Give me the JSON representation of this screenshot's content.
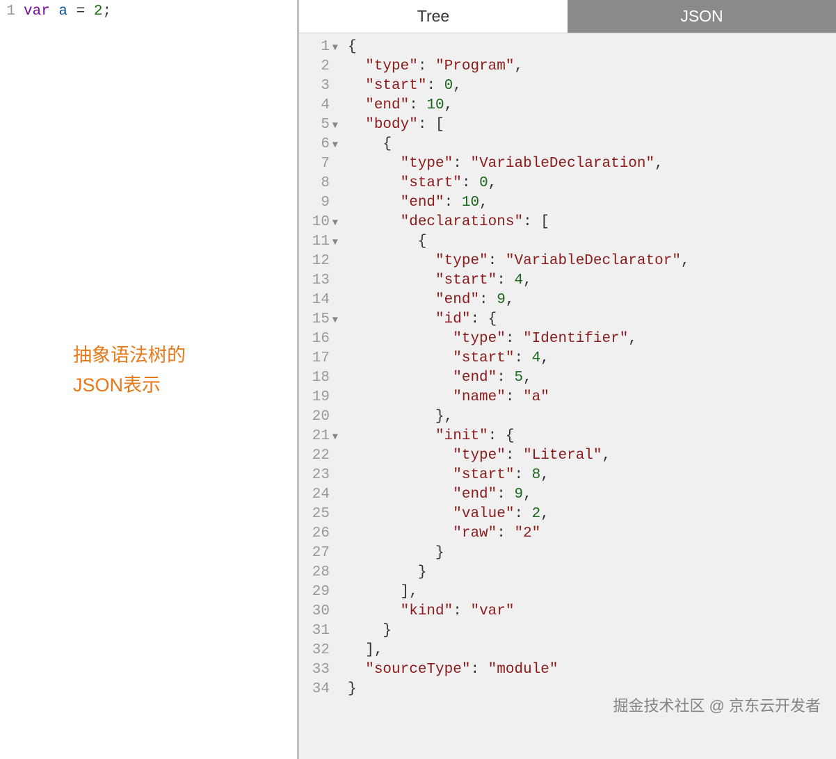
{
  "left": {
    "line_number": "1",
    "code_tokens": {
      "var": "var",
      "a": "a",
      "eq": "=",
      "two": "2",
      "semi": ";"
    },
    "annotation_line1": "抽象语法树的",
    "annotation_line2": "JSON表示"
  },
  "tabs": {
    "tree": "Tree",
    "json": "JSON"
  },
  "json_lines": [
    {
      "n": "1",
      "fold": true,
      "indent": 0,
      "raw": [
        {
          "t": "punc",
          "v": "{"
        }
      ]
    },
    {
      "n": "2",
      "indent": 1,
      "raw": [
        {
          "t": "key",
          "v": "\"type\""
        },
        {
          "t": "punc",
          "v": ": "
        },
        {
          "t": "str",
          "v": "\"Program\""
        },
        {
          "t": "punc",
          "v": ","
        }
      ]
    },
    {
      "n": "3",
      "indent": 1,
      "raw": [
        {
          "t": "key",
          "v": "\"start\""
        },
        {
          "t": "punc",
          "v": ": "
        },
        {
          "t": "num",
          "v": "0"
        },
        {
          "t": "punc",
          "v": ","
        }
      ]
    },
    {
      "n": "4",
      "indent": 1,
      "raw": [
        {
          "t": "key",
          "v": "\"end\""
        },
        {
          "t": "punc",
          "v": ": "
        },
        {
          "t": "num",
          "v": "10"
        },
        {
          "t": "punc",
          "v": ","
        }
      ]
    },
    {
      "n": "5",
      "fold": true,
      "indent": 1,
      "raw": [
        {
          "t": "key",
          "v": "\"body\""
        },
        {
          "t": "punc",
          "v": ": ["
        }
      ]
    },
    {
      "n": "6",
      "fold": true,
      "indent": 2,
      "raw": [
        {
          "t": "punc",
          "v": "{"
        }
      ]
    },
    {
      "n": "7",
      "indent": 3,
      "raw": [
        {
          "t": "key",
          "v": "\"type\""
        },
        {
          "t": "punc",
          "v": ": "
        },
        {
          "t": "str",
          "v": "\"VariableDeclaration\""
        },
        {
          "t": "punc",
          "v": ","
        }
      ]
    },
    {
      "n": "8",
      "indent": 3,
      "raw": [
        {
          "t": "key",
          "v": "\"start\""
        },
        {
          "t": "punc",
          "v": ": "
        },
        {
          "t": "num",
          "v": "0"
        },
        {
          "t": "punc",
          "v": ","
        }
      ]
    },
    {
      "n": "9",
      "indent": 3,
      "raw": [
        {
          "t": "key",
          "v": "\"end\""
        },
        {
          "t": "punc",
          "v": ": "
        },
        {
          "t": "num",
          "v": "10"
        },
        {
          "t": "punc",
          "v": ","
        }
      ]
    },
    {
      "n": "10",
      "fold": true,
      "indent": 3,
      "raw": [
        {
          "t": "key",
          "v": "\"declarations\""
        },
        {
          "t": "punc",
          "v": ": ["
        }
      ]
    },
    {
      "n": "11",
      "fold": true,
      "indent": 4,
      "raw": [
        {
          "t": "punc",
          "v": "{"
        }
      ]
    },
    {
      "n": "12",
      "indent": 5,
      "raw": [
        {
          "t": "key",
          "v": "\"type\""
        },
        {
          "t": "punc",
          "v": ": "
        },
        {
          "t": "str",
          "v": "\"VariableDeclarator\""
        },
        {
          "t": "punc",
          "v": ","
        }
      ]
    },
    {
      "n": "13",
      "indent": 5,
      "raw": [
        {
          "t": "key",
          "v": "\"start\""
        },
        {
          "t": "punc",
          "v": ": "
        },
        {
          "t": "num",
          "v": "4"
        },
        {
          "t": "punc",
          "v": ","
        }
      ]
    },
    {
      "n": "14",
      "indent": 5,
      "raw": [
        {
          "t": "key",
          "v": "\"end\""
        },
        {
          "t": "punc",
          "v": ": "
        },
        {
          "t": "num",
          "v": "9"
        },
        {
          "t": "punc",
          "v": ","
        }
      ]
    },
    {
      "n": "15",
      "fold": true,
      "indent": 5,
      "raw": [
        {
          "t": "key",
          "v": "\"id\""
        },
        {
          "t": "punc",
          "v": ": {"
        }
      ]
    },
    {
      "n": "16",
      "indent": 6,
      "raw": [
        {
          "t": "key",
          "v": "\"type\""
        },
        {
          "t": "punc",
          "v": ": "
        },
        {
          "t": "str",
          "v": "\"Identifier\""
        },
        {
          "t": "punc",
          "v": ","
        }
      ]
    },
    {
      "n": "17",
      "indent": 6,
      "raw": [
        {
          "t": "key",
          "v": "\"start\""
        },
        {
          "t": "punc",
          "v": ": "
        },
        {
          "t": "num",
          "v": "4"
        },
        {
          "t": "punc",
          "v": ","
        }
      ]
    },
    {
      "n": "18",
      "indent": 6,
      "raw": [
        {
          "t": "key",
          "v": "\"end\""
        },
        {
          "t": "punc",
          "v": ": "
        },
        {
          "t": "num",
          "v": "5"
        },
        {
          "t": "punc",
          "v": ","
        }
      ]
    },
    {
      "n": "19",
      "indent": 6,
      "raw": [
        {
          "t": "key",
          "v": "\"name\""
        },
        {
          "t": "punc",
          "v": ": "
        },
        {
          "t": "str",
          "v": "\"a\""
        }
      ]
    },
    {
      "n": "20",
      "indent": 5,
      "raw": [
        {
          "t": "punc",
          "v": "},"
        }
      ]
    },
    {
      "n": "21",
      "fold": true,
      "indent": 5,
      "raw": [
        {
          "t": "key",
          "v": "\"init\""
        },
        {
          "t": "punc",
          "v": ": {"
        }
      ]
    },
    {
      "n": "22",
      "indent": 6,
      "raw": [
        {
          "t": "key",
          "v": "\"type\""
        },
        {
          "t": "punc",
          "v": ": "
        },
        {
          "t": "str",
          "v": "\"Literal\""
        },
        {
          "t": "punc",
          "v": ","
        }
      ]
    },
    {
      "n": "23",
      "indent": 6,
      "raw": [
        {
          "t": "key",
          "v": "\"start\""
        },
        {
          "t": "punc",
          "v": ": "
        },
        {
          "t": "num",
          "v": "8"
        },
        {
          "t": "punc",
          "v": ","
        }
      ]
    },
    {
      "n": "24",
      "indent": 6,
      "raw": [
        {
          "t": "key",
          "v": "\"end\""
        },
        {
          "t": "punc",
          "v": ": "
        },
        {
          "t": "num",
          "v": "9"
        },
        {
          "t": "punc",
          "v": ","
        }
      ]
    },
    {
      "n": "25",
      "indent": 6,
      "raw": [
        {
          "t": "key",
          "v": "\"value\""
        },
        {
          "t": "punc",
          "v": ": "
        },
        {
          "t": "num",
          "v": "2"
        },
        {
          "t": "punc",
          "v": ","
        }
      ]
    },
    {
      "n": "26",
      "indent": 6,
      "raw": [
        {
          "t": "key",
          "v": "\"raw\""
        },
        {
          "t": "punc",
          "v": ": "
        },
        {
          "t": "str",
          "v": "\"2\""
        }
      ]
    },
    {
      "n": "27",
      "indent": 5,
      "raw": [
        {
          "t": "punc",
          "v": "}"
        }
      ]
    },
    {
      "n": "28",
      "indent": 4,
      "raw": [
        {
          "t": "punc",
          "v": "}"
        }
      ]
    },
    {
      "n": "29",
      "indent": 3,
      "raw": [
        {
          "t": "punc",
          "v": "],"
        }
      ]
    },
    {
      "n": "30",
      "indent": 3,
      "raw": [
        {
          "t": "key",
          "v": "\"kind\""
        },
        {
          "t": "punc",
          "v": ": "
        },
        {
          "t": "str",
          "v": "\"var\""
        }
      ]
    },
    {
      "n": "31",
      "indent": 2,
      "raw": [
        {
          "t": "punc",
          "v": "}"
        }
      ]
    },
    {
      "n": "32",
      "indent": 1,
      "raw": [
        {
          "t": "punc",
          "v": "],"
        }
      ]
    },
    {
      "n": "33",
      "indent": 1,
      "raw": [
        {
          "t": "key",
          "v": "\"sourceType\""
        },
        {
          "t": "punc",
          "v": ": "
        },
        {
          "t": "str",
          "v": "\"module\""
        }
      ]
    },
    {
      "n": "34",
      "indent": 0,
      "raw": [
        {
          "t": "punc",
          "v": "}"
        }
      ]
    }
  ],
  "watermark": "掘金技术社区 @ 京东云开发者"
}
